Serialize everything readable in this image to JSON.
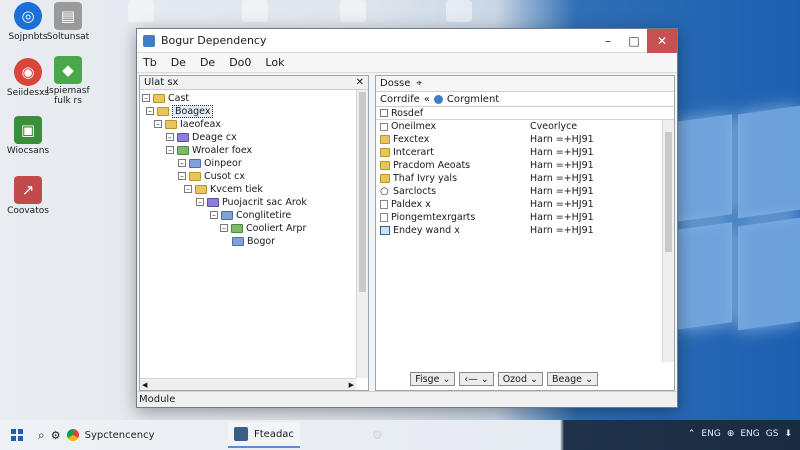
{
  "desktop_icons": [
    {
      "label": "Sojpnbts",
      "icon": "app-icon",
      "color": "#1d6fd8"
    },
    {
      "label": "Soltunsat",
      "icon": "document-icon",
      "color": "#9a9a9a"
    },
    {
      "label": "Seiidesxs",
      "icon": "chrome-icon",
      "color": "#d9453b"
    },
    {
      "label": "Ispiemasf",
      "icon": "map-icon",
      "color": "#4aa84a"
    },
    {
      "label": "fulk rs",
      "icon": "",
      "color": ""
    },
    {
      "label": "Wiocsans",
      "icon": "photo-icon",
      "color": "#3a8f3a"
    },
    {
      "label": "Coovatos",
      "icon": "shortcut-icon",
      "color": "#c24a4a"
    }
  ],
  "window": {
    "title": "Bogur Dependency",
    "controls": {
      "minimize": "–",
      "maximize": "□",
      "close": "✕"
    },
    "toolbar": [
      "Tb",
      "De",
      "De",
      "Do0",
      "Lok"
    ],
    "left_pane": {
      "header": "Ulat sx",
      "tree": [
        {
          "label": "Cast",
          "depth": 0,
          "color": "yellow",
          "expander": "–"
        },
        {
          "label": "Boagex",
          "depth": 1,
          "color": "yellow",
          "expander": "–",
          "selected": true
        },
        {
          "label": "Iaeofeax",
          "depth": 2,
          "color": "yellow",
          "expander": "–"
        },
        {
          "label": "Deage cx",
          "depth": 3,
          "color": "purple",
          "expander": "–"
        },
        {
          "label": "Wroaler foex",
          "depth": 3,
          "color": "green",
          "expander": "–"
        },
        {
          "label": "Oinpeor",
          "depth": 4,
          "color": "blue",
          "expander": "–"
        },
        {
          "label": "Cusot cx",
          "depth": 4,
          "color": "yellow",
          "expander": "–"
        },
        {
          "label": "Kvcem tiek",
          "depth": 4,
          "color": "yellow",
          "expander": "–"
        },
        {
          "label": "Puojacrit sac Arok",
          "depth": 5,
          "color": "purple",
          "expander": "–"
        },
        {
          "label": "Conglitetire",
          "depth": 6,
          "color": "blue",
          "expander": "–"
        },
        {
          "label": "Cooliert Arpr",
          "depth": 7,
          "color": "green",
          "expander": "–"
        },
        {
          "label": "Bogor",
          "depth": 7,
          "color": "blue",
          "expander": ""
        }
      ]
    },
    "right_pane": {
      "header": "Dosse",
      "header_pin": "⌖",
      "path_left": "Corrdife",
      "path_sep": "«",
      "path_right": "Corgmlent",
      "subheader": "Rosdef",
      "rows": [
        {
          "name": "Oneilmex",
          "value": "Cveorlyce",
          "icon": "none"
        },
        {
          "name": "Fexctex",
          "value": "Harn =+HJ91",
          "icon": "folder"
        },
        {
          "name": "Intcerart",
          "value": "Harn =+HJ91",
          "icon": "folder"
        },
        {
          "name": "Pracdom Aeoats",
          "value": "Harn =+HJ91",
          "icon": "folder"
        },
        {
          "name": "Thaf Ivry yals",
          "value": "Harn =+HJ91",
          "icon": "folder"
        },
        {
          "name": "Sarclocts",
          "value": "Harn =+HJ91",
          "icon": "search"
        },
        {
          "name": "Paldex x",
          "value": "Harn =+HJ91",
          "icon": "file"
        },
        {
          "name": "Piongemtexrgarts",
          "value": "Harn =+HJ91",
          "icon": "file"
        },
        {
          "name": "Endey wand x",
          "value": "Harn =+HJ91",
          "icon": "window"
        }
      ],
      "buttons": [
        {
          "label": "Fisge",
          "caret": "⌄"
        },
        {
          "label": "‹—",
          "caret": "⌄"
        },
        {
          "label": "Ozod",
          "caret": "⌄"
        },
        {
          "label": "Beage",
          "caret": "⌄"
        }
      ]
    },
    "status": "Module"
  },
  "taskbar": {
    "search_item": "Sypctencency",
    "app_label": "Fteadac",
    "tray": [
      "⌃",
      "ENG",
      "⊕",
      "ENG",
      "GS",
      "⬇"
    ]
  }
}
